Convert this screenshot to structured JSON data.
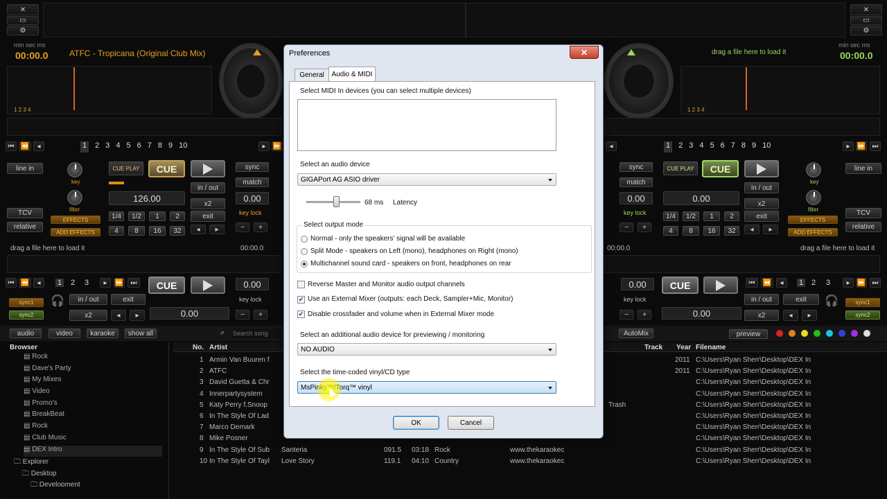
{
  "deck_left": {
    "time_label": "min sec ms",
    "time": "00:00.0",
    "track_title": "ATFC - Tropicana (Original Club Mix)",
    "loop_nums": "1 2 3 4",
    "hot_cues": [
      "1",
      "2",
      "3",
      "4",
      "5",
      "6",
      "7",
      "8",
      "9",
      "10"
    ],
    "line_in": "line in",
    "tcv": "TCV",
    "relative": "relative",
    "key": "key",
    "filter": "filter",
    "effects": "EFFECTS",
    "add_effects": "ADD EFFECTS",
    "cue_play": "CUE PLAY",
    "cue": "CUE",
    "bpm": "126.00",
    "sync": "sync",
    "match": "match",
    "key_lock": "key lock",
    "in_out": "in / out",
    "x2": "x2",
    "exit": "exit",
    "pitch": "0.00",
    "loops": [
      "1/4",
      "1/2",
      "1",
      "2",
      "4",
      "8",
      "16",
      "32"
    ]
  },
  "deck_right": {
    "time_label": "min sec ms",
    "time": "00:00.0",
    "drag_text": "drag a file here to load it",
    "loop_nums": "1 2 3 4",
    "hot_cues": [
      "1",
      "2",
      "3",
      "4",
      "5",
      "6",
      "7",
      "8",
      "9",
      "10"
    ],
    "line_in": "line in",
    "tcv": "TCV",
    "relative": "relative",
    "key": "key",
    "filter": "filter",
    "effects": "EFFECTS",
    "add_effects": "ADD EFFECTS",
    "cue_play": "CUE PLAY",
    "cue": "CUE",
    "bpm": "0.00",
    "sync": "sync",
    "match": "match",
    "key_lock": "key lock",
    "in_out": "in / out",
    "x2": "x2",
    "exit": "exit",
    "pitch": "0.00",
    "loops": [
      "1/4",
      "1/2",
      "1",
      "2",
      "4",
      "8",
      "16",
      "32"
    ]
  },
  "sampler_left": {
    "drag_text": "drag a file here to load it",
    "time": "00:00.0",
    "nums": [
      "1",
      "2",
      "3"
    ],
    "cue": "CUE",
    "pitch": "0.00",
    "key_lock": "key lock",
    "in_out": "in / out",
    "exit": "exit",
    "x2": "x2",
    "vol": "0.00",
    "sync1": "sync1",
    "sync2": "sync2"
  },
  "sampler_right": {
    "drag_text": "drag a file here to load it",
    "time": "00:00.0",
    "nums": [
      "1",
      "2",
      "3"
    ],
    "cue": "CUE",
    "pitch": "0.00",
    "key_lock": "key lock",
    "in_out": "in / out",
    "exit": "exit",
    "x2": "x2",
    "vol": "0.00",
    "sync1": "sync1",
    "sync2": "sync2"
  },
  "toolbar": {
    "audio": "audio",
    "video": "video",
    "karaoke": "karaoke",
    "show_all": "show all",
    "search_placeholder": "Search song",
    "automix": "AutoMix",
    "preview": "preview"
  },
  "browser": {
    "header": "Browser",
    "items": [
      "Rock",
      "Dave's Party",
      "My Mixes",
      "Video",
      "Promo's",
      "BreakBeat",
      "Rock",
      "Club Music",
      "DEX Intro"
    ],
    "explorer": "Explorer",
    "desktop": "Desktop",
    "development": "Development"
  },
  "table": {
    "headers": {
      "no": "No.",
      "artist": "Artist",
      "track": "Track",
      "year": "Year",
      "filename": "Filename"
    },
    "rows": [
      {
        "no": "1",
        "artist": "Armin Van Buuren f",
        "year": "2011",
        "filename": "C:\\Users\\Ryan Sherr\\Desktop\\DEX In"
      },
      {
        "no": "2",
        "artist": "ATFC",
        "year": "2011",
        "filename": "C:\\Users\\Ryan Sherr\\Desktop\\DEX In"
      },
      {
        "no": "3",
        "artist": "David Guetta & Chr",
        "filename": "C:\\Users\\Ryan Sherr\\Desktop\\DEX In"
      },
      {
        "no": "4",
        "artist": "Innerpartysystem",
        "filename": "C:\\Users\\Ryan Sherr\\Desktop\\DEX In"
      },
      {
        "no": "5",
        "artist": "Katy Perry f.Snoop",
        "extra": "Trash",
        "filename": "C:\\Users\\Ryan Sherr\\Desktop\\DEX In"
      },
      {
        "no": "6",
        "artist": "In The Style Of Lad",
        "filename": "C:\\Users\\Ryan Sherr\\Desktop\\DEX In"
      },
      {
        "no": "7",
        "artist": "Marco Demark",
        "filename": "C:\\Users\\Ryan Sherr\\Desktop\\DEX In"
      },
      {
        "no": "8",
        "artist": "Mike Posner",
        "filename": "C:\\Users\\Ryan Sherr\\Desktop\\DEX In"
      },
      {
        "no": "9",
        "artist": "In The Style Of Sub",
        "title": "Santeria",
        "bpm": "091.5",
        "len": "03:18",
        "genre": "Rock",
        "url": "www.thekaraokec",
        "filename": "C:\\Users\\Ryan Sherr\\Desktop\\DEX In"
      },
      {
        "no": "10",
        "artist": "In The Style Of Tayl",
        "title": "Love Story",
        "bpm": "119.1",
        "len": "04:10",
        "genre": "Country",
        "url": "www.thekaraokec",
        "filename": "C:\\Users\\Ryan Sherr\\Desktop\\DEX In"
      }
    ]
  },
  "dialog": {
    "title": "Preferences",
    "close": "✕",
    "tabs": [
      "General",
      "Audio & MIDI"
    ],
    "midi_label": "Select MIDI In devices (you can select multiple devices)",
    "audio_device_label": "Select an audio device",
    "audio_device_value": "GIGAPort AG ASIO driver",
    "latency_value": "68 ms",
    "latency_label": "Latency",
    "output_mode_label": "Select output mode",
    "output_modes": [
      "Normal - only the speakers' signal will be available",
      "Split Mode - speakers on Left (mono), headphones on Right (mono)",
      "Multichannel sound card - speakers on front, headphones on rear"
    ],
    "checks": [
      "Reverse Master and Monitor audio output channels",
      "Use an External Mixer (outputs: each Deck, Sampler+Mic, Monitor)",
      "Disable crossfader and volume when in External Mixer mode"
    ],
    "preview_label": "Select an additional audio device for previewing / monitoring",
    "preview_value": "NO AUDIO",
    "vinyl_label": "Select the time-coded vinyl/CD type",
    "vinyl_value": "MsPinky™/Torq™ vinyl",
    "ok": "OK",
    "cancel": "Cancel"
  },
  "colors": {
    "accent_green": "#9fd85a",
    "accent_orange": "#e08a1a",
    "dialog_bg": "#dfe6ef"
  }
}
